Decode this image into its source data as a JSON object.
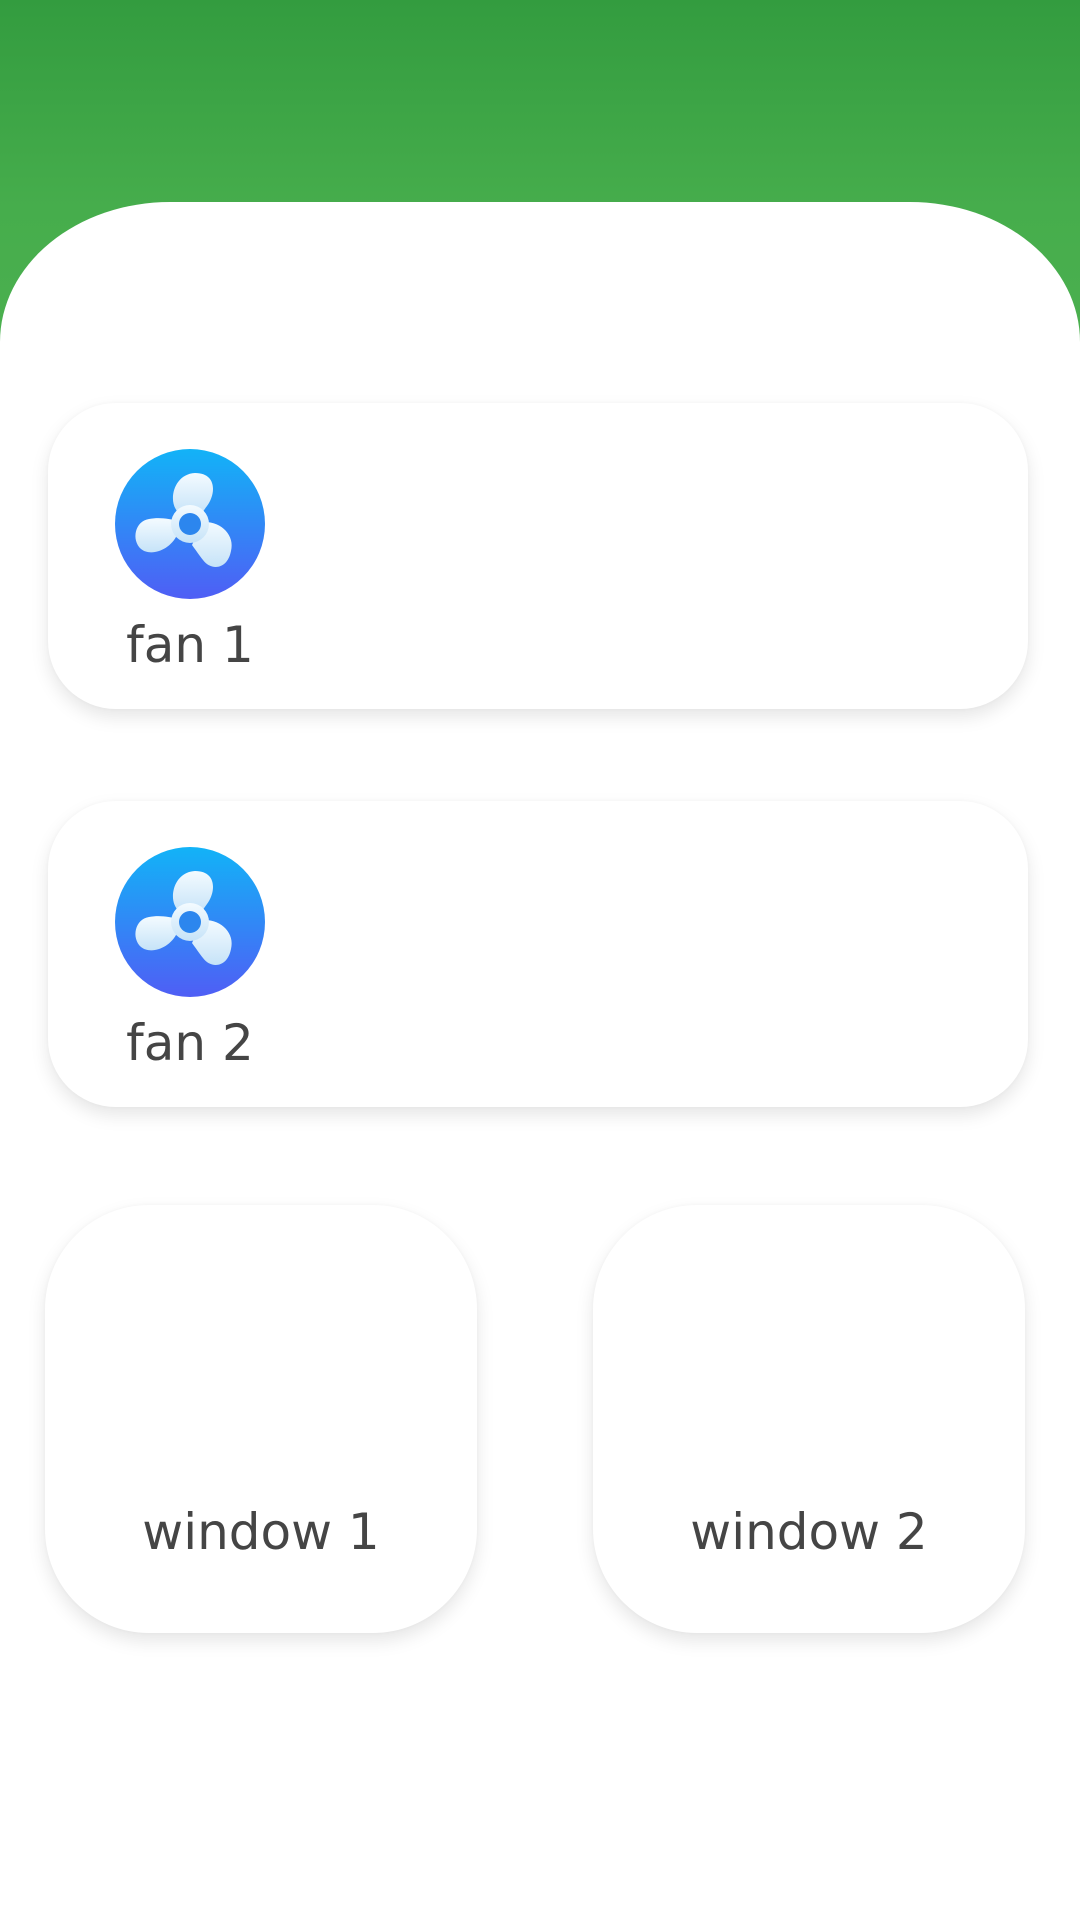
{
  "colors": {
    "header_green": "#3aa443",
    "fan_icon_gradient_top": "#12b3f7",
    "fan_icon_gradient_bottom": "#4f5ef5",
    "label_text": "#454545"
  },
  "devices": {
    "fans": [
      {
        "label": "fan 1",
        "icon": "fan-icon"
      },
      {
        "label": "fan 2",
        "icon": "fan-icon"
      }
    ],
    "windows": [
      {
        "label": "window 1"
      },
      {
        "label": "window 2"
      }
    ]
  }
}
